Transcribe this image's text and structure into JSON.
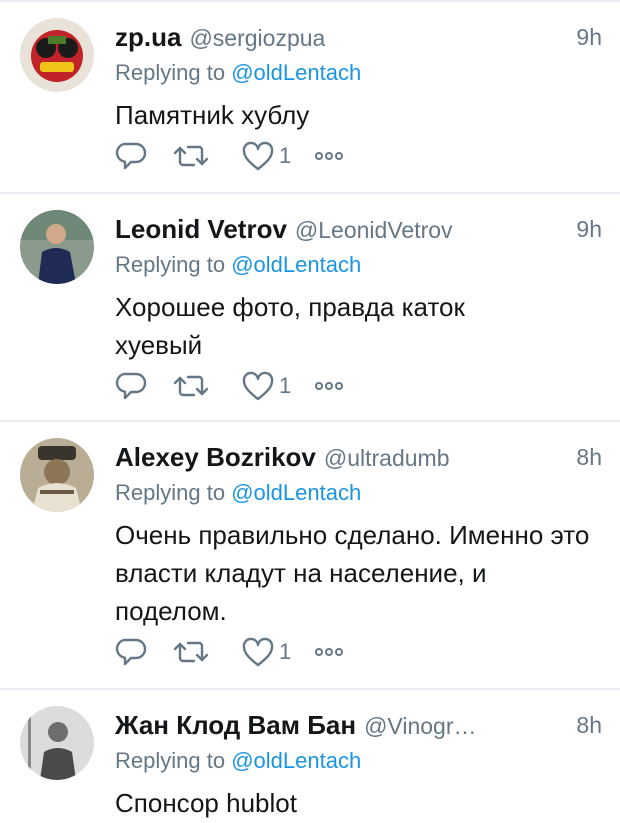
{
  "icons": {
    "reply": "reply-icon",
    "retweet": "retweet-icon",
    "like": "heart-icon",
    "more": "more-icon"
  },
  "colors": {
    "link": "#1b95e0",
    "muted": "#657786",
    "text": "#14171a",
    "divider": "#e6ecf0"
  },
  "tweets": [
    {
      "name": "zp.ua",
      "handle": "@sergiozpua",
      "time": "9h",
      "replying_prefix": "Replying to",
      "replying_to": "@oldLentach",
      "text": "Памятниk хублу",
      "likes": "1"
    },
    {
      "name": "Leonid Vetrov",
      "handle": "@LeonidVetrov",
      "time": "9h",
      "replying_prefix": "Replying to",
      "replying_to": "@oldLentach",
      "text": "Хорошее фото, правда каток хуевый",
      "likes": "1"
    },
    {
      "name": "Alexey Bozrikov",
      "handle": "@ultradumb",
      "time": "8h",
      "replying_prefix": "Replying to",
      "replying_to": "@oldLentach",
      "text": "Очень правильно сделано. Именно это власти кладут на население, и поделом.",
      "likes": "1"
    },
    {
      "name": "Жан Клод Вам Бан",
      "handle": "@Vinogradov...",
      "time": "8h",
      "replying_prefix": "Replying to",
      "replying_to": "@oldLentach",
      "text": "Спонсор hublot"
    }
  ]
}
